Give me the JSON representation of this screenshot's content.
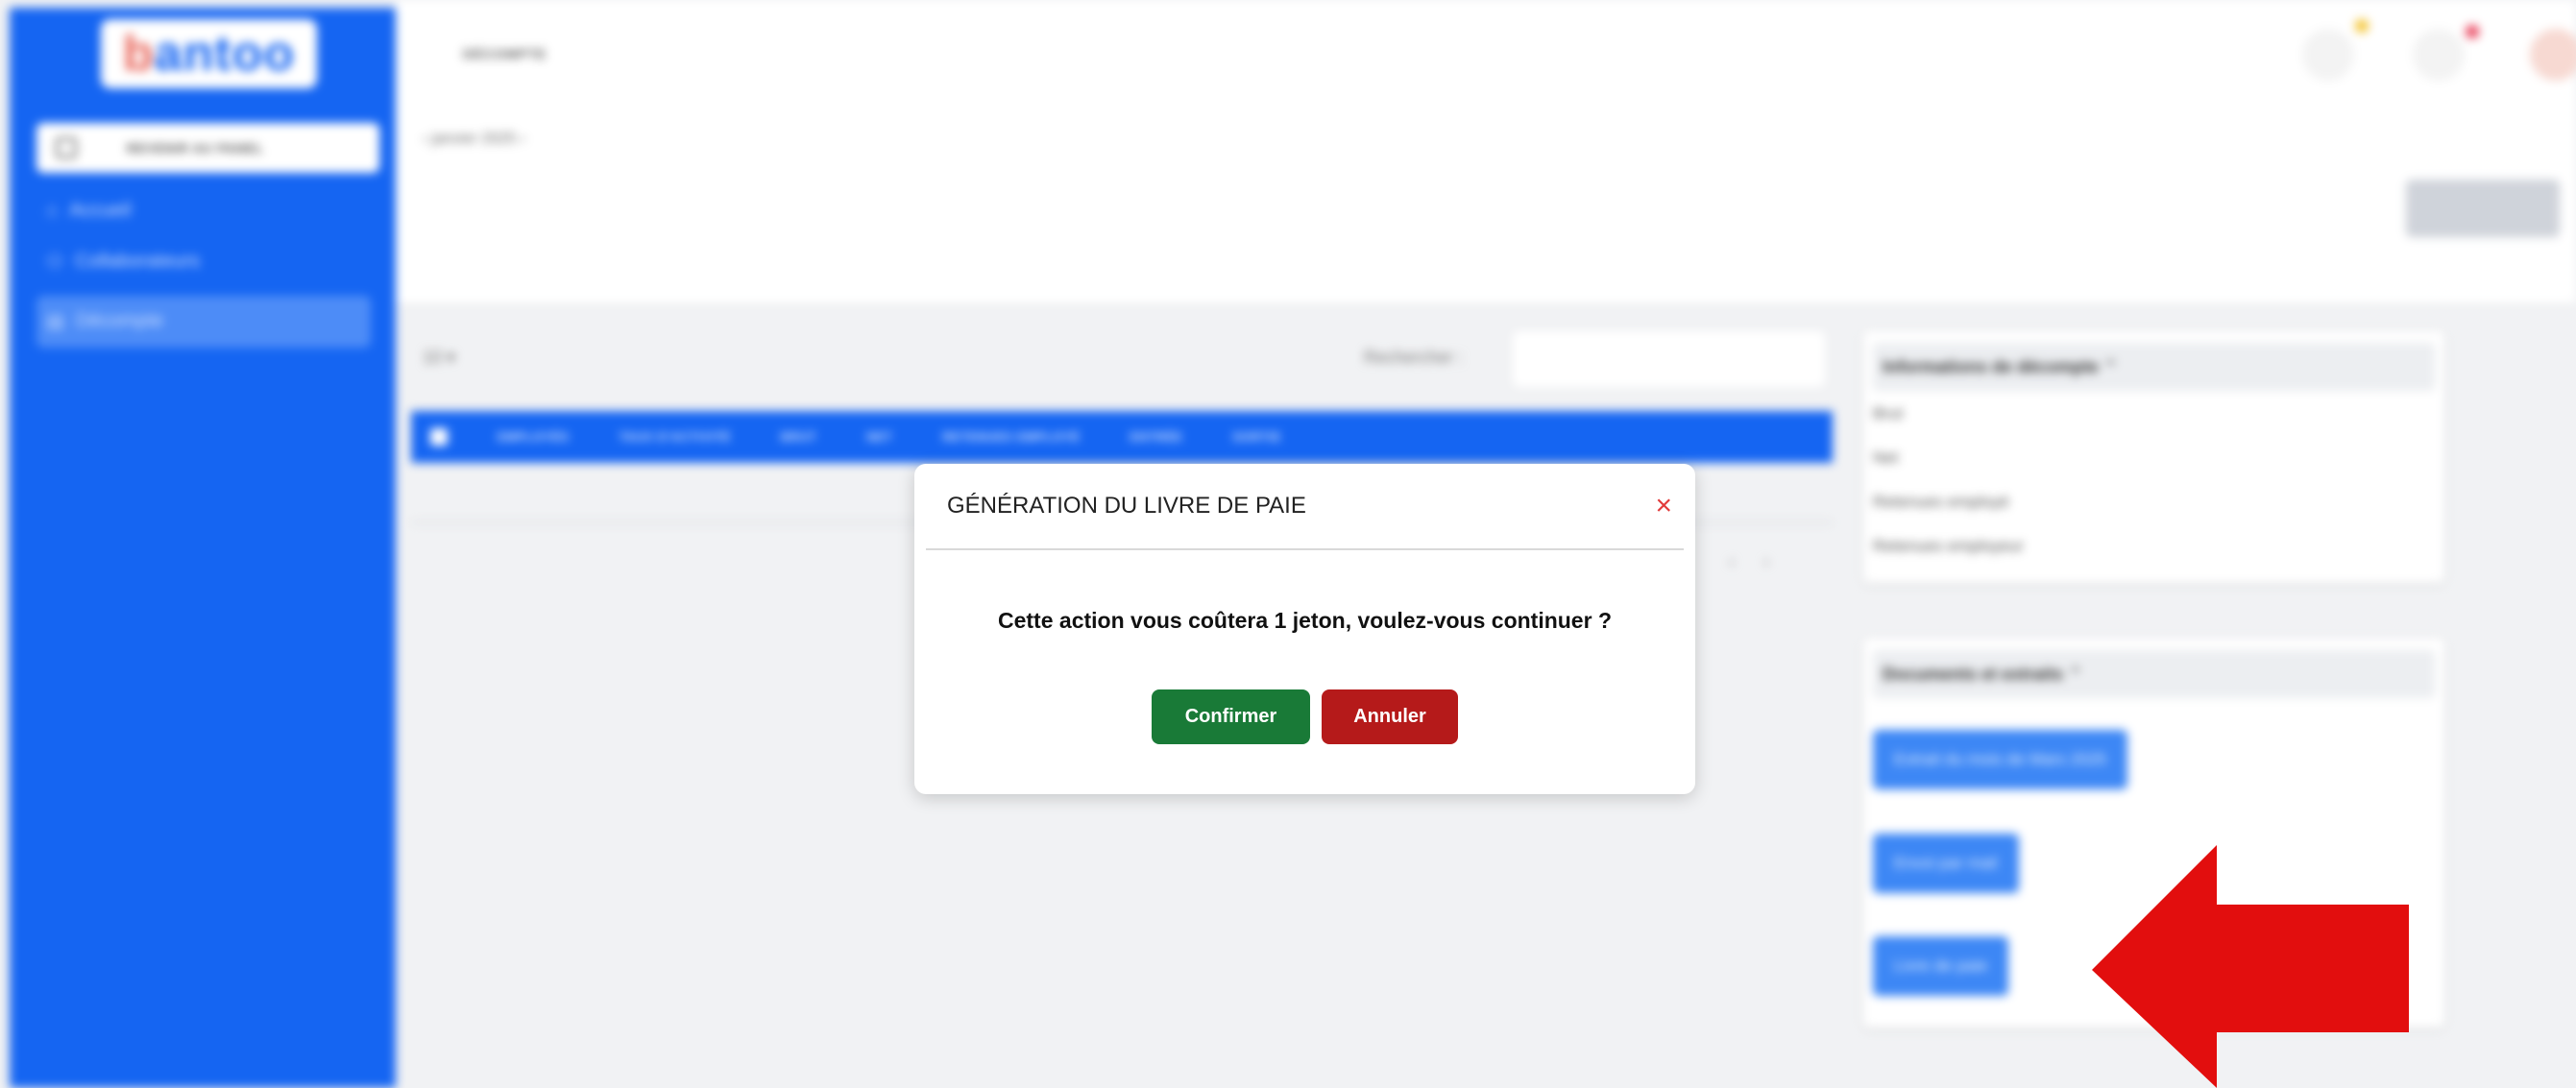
{
  "sidebar": {
    "logo_text_b": "b",
    "logo_text_rest": "antoo",
    "back_label": "REVENIR AU PANEL",
    "items": [
      {
        "label": "Accueil",
        "icon": "home-icon"
      },
      {
        "label": "Collaborateurs",
        "icon": "users-icon"
      },
      {
        "label": "Décompte",
        "icon": "document-icon"
      }
    ]
  },
  "header": {
    "title": "DÉCOMPTE"
  },
  "period": {
    "label": "janvier 2025"
  },
  "table": {
    "per_page": "10",
    "search_label": "Rechercher :",
    "columns": [
      "EMPLOYÉS",
      "TAUX D'ACTIVITÉ",
      "BRUT",
      "NET",
      "RETENUES EMPLOYÉ",
      "ENTRÉE",
      "SORTIE"
    ]
  },
  "info_panel": {
    "title": "Informations de décompte",
    "rows": [
      "Brut",
      "Net",
      "Retenues employé",
      "Retenues employeur"
    ]
  },
  "docs_panel": {
    "title": "Documents et extraits",
    "buttons": [
      "Extrait du mois de Mars 2025",
      "Envoi par mail",
      "Livre de paie"
    ]
  },
  "modal": {
    "title": "GÉNÉRATION DU LIVRE DE PAIE",
    "close_glyph": "×",
    "message": "Cette action vous coûtera 1 jeton, voulez-vous continuer ?",
    "confirm_label": "Confirmer",
    "cancel_label": "Annuler"
  },
  "colors": {
    "brand": "#1565f2",
    "confirm": "#197a37",
    "cancel": "#b51a1a",
    "annotation_arrow": "#e20e0e"
  }
}
